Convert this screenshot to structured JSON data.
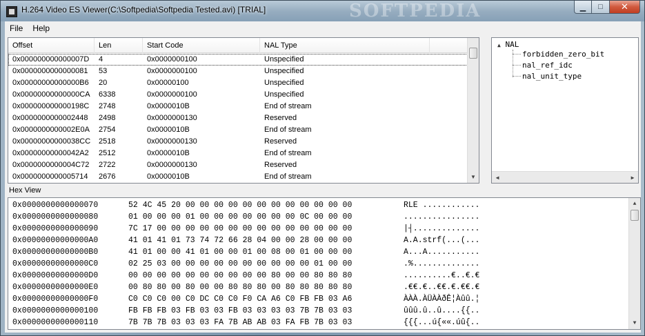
{
  "window": {
    "title": "H.264 Video ES Viewer(C:\\Softpedia\\Softpedia Tested.avi) [TRIAL]",
    "watermark": "SOFTPEDIA",
    "minimize_glyph": "▁",
    "maximize_glyph": "□",
    "close_glyph": "✕"
  },
  "menu": {
    "file": "File",
    "help": "Help"
  },
  "nal_table": {
    "columns": [
      "Offset",
      "Len",
      "Start Code",
      "NAL Type"
    ],
    "rows": [
      {
        "offset": "0x000000000000007D",
        "len": "4",
        "start_code": "0x0000000100",
        "type": "Unspecified"
      },
      {
        "offset": "0x0000000000000081",
        "len": "53",
        "start_code": "0x0000000100",
        "type": "Unspecified"
      },
      {
        "offset": "0x00000000000000B6",
        "len": "20",
        "start_code": "0x00000100",
        "type": "Unspecified"
      },
      {
        "offset": "0x00000000000000CA",
        "len": "6338",
        "start_code": "0x0000000100",
        "type": "Unspecified"
      },
      {
        "offset": "0x000000000000198C",
        "len": "2748",
        "start_code": "0x0000010B",
        "type": "End of stream"
      },
      {
        "offset": "0x0000000000002448",
        "len": "2498",
        "start_code": "0x0000000130",
        "type": "Reserved"
      },
      {
        "offset": "0x0000000000002E0A",
        "len": "2754",
        "start_code": "0x0000010B",
        "type": "End of stream"
      },
      {
        "offset": "0x00000000000038CC",
        "len": "2518",
        "start_code": "0x0000000130",
        "type": "Reserved"
      },
      {
        "offset": "0x00000000000042A2",
        "len": "2512",
        "start_code": "0x0000010B",
        "type": "End of stream"
      },
      {
        "offset": "0x0000000000004C72",
        "len": "2722",
        "start_code": "0x0000000130",
        "type": "Reserved"
      },
      {
        "offset": "0x0000000000005714",
        "len": "2676",
        "start_code": "0x0000010B",
        "type": "End of stream"
      }
    ]
  },
  "tree": {
    "expander": "▲",
    "root": "NAL",
    "children": [
      "forbidden_zero_bit",
      "nal_ref_idc",
      "nal_unit_type"
    ]
  },
  "hex_view": {
    "label": "Hex View",
    "rows": [
      {
        "addr": "0x0000000000000070",
        "bytes": "52 4C 45 20 00 00 00 00 00 00 00 00 00 00 00 00",
        "ascii": "RLE ............"
      },
      {
        "addr": "0x0000000000000080",
        "bytes": "01 00 00 00 01 00 00 00 00 00 00 00 0C 00 00 00",
        "ascii": "................"
      },
      {
        "addr": "0x0000000000000090",
        "bytes": "7C 17 00 00 00 00 00 00 00 00 00 00 00 00 00 00",
        "ascii": "|┤.............."
      },
      {
        "addr": "0x00000000000000A0",
        "bytes": "41 01 41 01 73 74 72 66 28 04 00 00 28 00 00 00",
        "ascii": "A.A.strf(...(..."
      },
      {
        "addr": "0x00000000000000B0",
        "bytes": "41 01 00 00 41 01 00 00 01 00 08 00 01 00 00 00",
        "ascii": "A...A..........."
      },
      {
        "addr": "0x00000000000000C0",
        "bytes": "02 25 03 00 00 00 00 00 00 00 00 00 00 01 00 00",
        "ascii": ".%.............."
      },
      {
        "addr": "0x00000000000000D0",
        "bytes": "00 00 00 00 00 00 00 00 00 00 80 00 00 80 80 80",
        "ascii": "..........€..€.€"
      },
      {
        "addr": "0x00000000000000E0",
        "bytes": "00 80 80 00 80 00 00 80 80 80 00 80 80 80 80 80",
        "ascii": ".€€.€..€€.€.€€.€"
      },
      {
        "addr": "0x00000000000000F0",
        "bytes": "C0 C0 C0 00 C0 DC C0 C0 F0 CA A6 C0 FB FB 03 A6",
        "ascii": "ÀÀÀ.ÀÜÀÀðÊ¦Àûû.¦"
      },
      {
        "addr": "0x0000000000000100",
        "bytes": "FB FB FB 03 FB 03 03 FB 03 03 03 03 7B 7B 03 03",
        "ascii": "ûûû.û..û....{{.."
      },
      {
        "addr": "0x0000000000000110",
        "bytes": "7B 7B 7B 03 03 03 FA 7B AB AB 03 FA FB 7B 03 03",
        "ascii": "{{{...ú{««.úû{.."
      }
    ]
  },
  "scrollbar": {
    "up": "▲",
    "down": "▼",
    "left": "◀",
    "right": "▶"
  }
}
